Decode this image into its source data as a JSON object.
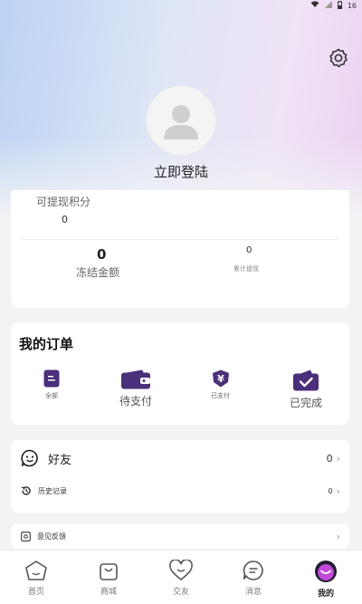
{
  "status": {
    "battery": "16"
  },
  "header": {
    "login_text": "立即登陆"
  },
  "points": {
    "withdrawable_label": "可提现积分",
    "withdrawable_value": "0",
    "frozen_value": "0",
    "frozen_label": "冻结金额",
    "accumulated_value": "0",
    "accumulated_label": "累计提现"
  },
  "orders": {
    "title": "我的订单",
    "items": [
      {
        "label": "全部",
        "icon": "list-icon"
      },
      {
        "label": "待支付",
        "icon": "wallet-icon"
      },
      {
        "label": "已支付",
        "icon": "yen-shield-icon"
      },
      {
        "label": "已完成",
        "icon": "check-folder-icon"
      }
    ]
  },
  "list": {
    "friends_label": "好友",
    "friends_count": "0",
    "history_label": "历史记录",
    "history_count": "0",
    "feedback_label": "意见反馈"
  },
  "tabbar": {
    "items": [
      {
        "label": "首页",
        "icon": "home-icon"
      },
      {
        "label": "商城",
        "icon": "shopping-bag-icon"
      },
      {
        "label": "交友",
        "icon": "heart-icon"
      },
      {
        "label": "消息",
        "icon": "message-icon"
      },
      {
        "label": "我的",
        "icon": "smiley-icon"
      }
    ],
    "active_index": 4
  },
  "colors": {
    "accent": "#5b3f8c",
    "active_tab": "#c04ad8"
  }
}
